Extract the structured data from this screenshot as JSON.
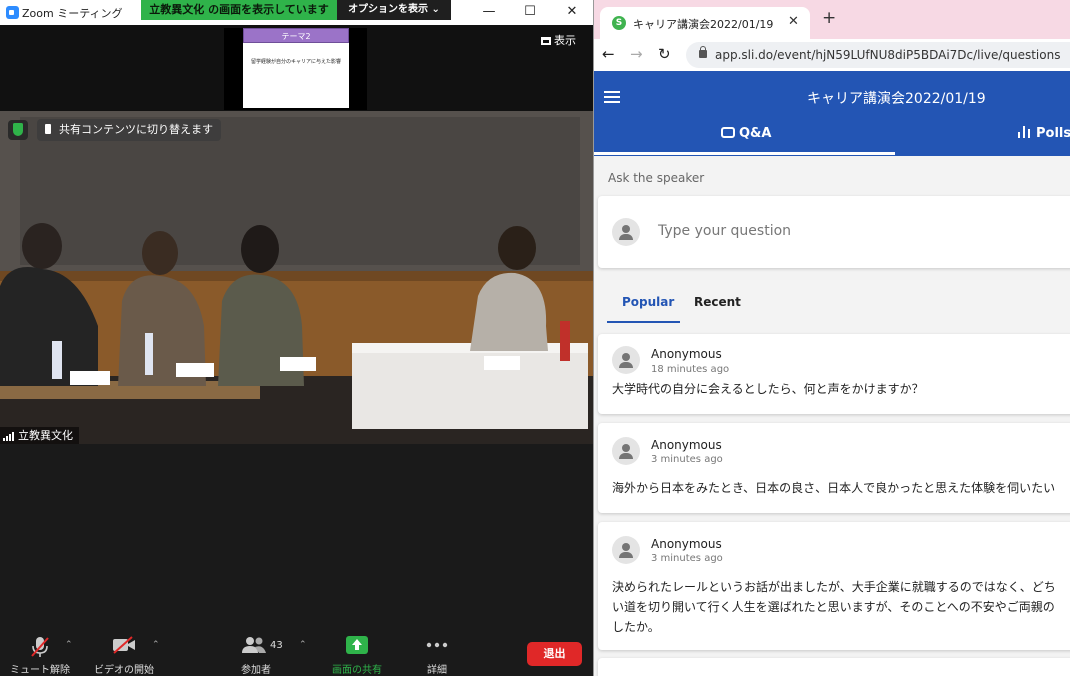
{
  "zoom": {
    "window_title": "Zoom ミーティング",
    "share_banner": "立教異文化 の画面を表示しています",
    "options_button": "オプションを表示 ⌄",
    "view_button": "表示",
    "slide": {
      "header": "テーマ2",
      "body": "留学経験が自分のキャリアに与えた影響"
    },
    "switch_button": "共有コンテンツに切り替えます",
    "participant_name": "立教異文化",
    "toolbar": {
      "mute": "ミュート解除",
      "video": "ビデオの開始",
      "participants": "参加者",
      "participants_count": "43",
      "share": "画面の共有",
      "more": "詳細",
      "leave": "退出"
    },
    "colors": {
      "share_green": "#2fb34a",
      "leave_red": "#e02828"
    }
  },
  "browser": {
    "tab_title": "キャリア講演会2022/01/19",
    "favicon_letter": "S",
    "url": "app.sli.do/event/hjN59LUfNU8diP5BDAi7Dc/live/questions"
  },
  "slido": {
    "event_title": "キャリア講演会2022/01/19",
    "tabs": {
      "qa": "Q&A",
      "polls": "Polls"
    },
    "ask_label": "Ask the speaker",
    "ask_placeholder": "Type your question",
    "sort": {
      "popular": "Popular",
      "recent": "Recent"
    },
    "questions": [
      {
        "author": "Anonymous",
        "time": "18 minutes ago",
        "lines": [
          "大学時代の自分に会えるとしたら、何と声をかけますか？"
        ]
      },
      {
        "author": "Anonymous",
        "time": "3 minutes ago",
        "lines": [
          "海外から日本をみたとき、日本の良さ、日本人で良かったと思えた体験を伺いたい"
        ]
      },
      {
        "author": "Anonymous",
        "time": "3 minutes ago",
        "lines": [
          "決められたレールというお話が出ましたが、大手企業に就職するのではなく、どち",
          "い道を切り開いて行く人生を選ばれたと思いますが、そのことへの不安やご両親の",
          "したか。"
        ]
      }
    ],
    "colors": {
      "header_blue": "#2355b4"
    }
  }
}
